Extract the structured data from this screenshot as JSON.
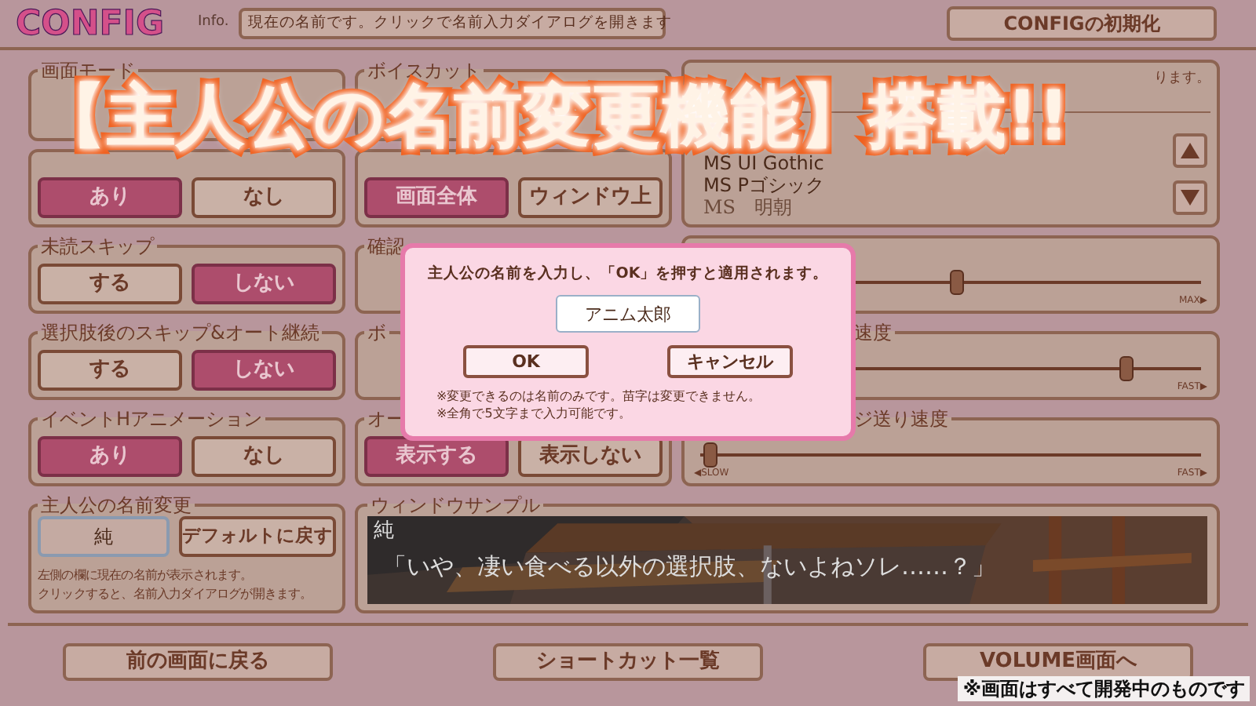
{
  "header": {
    "logo": "CONFIG",
    "info_label": "Info.",
    "info_text": "現在の名前です。クリックで名前入力ダイアログを開きます",
    "reset_button": "CONFIGの初期化"
  },
  "left_groups": [
    {
      "label": "画面モード"
    },
    {
      "options": [
        {
          "label": "あり",
          "selected": true
        },
        {
          "label": "なし",
          "selected": false
        }
      ]
    },
    {
      "label": "未読スキップ",
      "options": [
        {
          "label": "する",
          "selected": false
        },
        {
          "label": "しない",
          "selected": true
        }
      ]
    },
    {
      "label": "選択肢後のスキップ&オート継続",
      "options": [
        {
          "label": "する",
          "selected": false
        },
        {
          "label": "しない",
          "selected": true
        }
      ]
    },
    {
      "label": "イベントHアニメーション",
      "options": [
        {
          "label": "あり",
          "selected": true
        },
        {
          "label": "なし",
          "selected": false
        }
      ]
    }
  ],
  "middle_groups": [
    {
      "label": "ボイスカット"
    },
    {
      "options": [
        {
          "label": "画面全体",
          "selected": true
        },
        {
          "label": "ウィンドウ上",
          "selected": false
        }
      ]
    },
    {
      "label": "確認"
    },
    {
      "label": "ボ"
    },
    {
      "label": "オー",
      "options": [
        {
          "label": "表示する",
          "selected": true
        },
        {
          "label": "表示しない",
          "selected": false
        }
      ]
    }
  ],
  "font_box": {
    "note": "ります。",
    "fonts": [
      {
        "name": "MS UI Gothic",
        "kind": "gothic"
      },
      {
        "name": "MS Pゴシック",
        "kind": "gothic"
      },
      {
        "name": "MS　明朝",
        "kind": "mincho"
      }
    ]
  },
  "sliders": [
    {
      "level": 0.51,
      "end_label": "MAX▶"
    },
    {
      "label": "速度",
      "level": 0.85,
      "end_label": "FAST▶"
    },
    {
      "label": "ジ送り速度",
      "level": 0.02,
      "start_label": "◀SLOW",
      "end_label": "FAST▶"
    }
  ],
  "name_group": {
    "label": "主人公の名前変更",
    "name_value": "純",
    "default_button": "デフォルトに戻す",
    "note_lines": [
      "左側の欄に現在の名前が表示されます。",
      "クリックすると、名前入力ダイアログが開きます。"
    ]
  },
  "window_sample": {
    "label": "ウィンドウサンプル",
    "speaker": "純",
    "line": "「いや、凄い食べる以外の選択肢、ないよねソレ……？」"
  },
  "bottom_buttons": [
    "前の画面に戻る",
    "ショートカット一覧",
    "VOLUME画面へ"
  ],
  "disclaimer": "※画面はすべて開発中のものです",
  "banner": "【主人公の名前変更機能】搭載!!",
  "dialog": {
    "message": "主人公の名前を入力し、「OK」を押すと適用されます。",
    "input_value": "アニム太郎",
    "ok_button": "OK",
    "cancel_button": "キャンセル",
    "notes": [
      "※変更できるのは名前のみです。苗字は変更できません。",
      "※全角で5文字まで入力可能です。"
    ]
  }
}
